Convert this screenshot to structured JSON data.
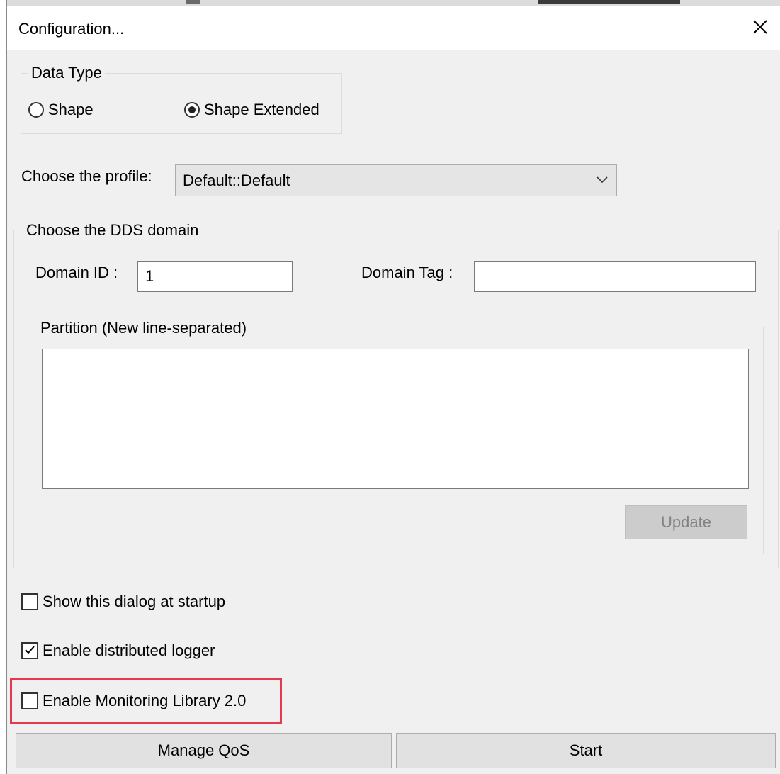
{
  "window": {
    "title": "Configuration..."
  },
  "data_type": {
    "legend": "Data Type",
    "options": [
      {
        "label": "Shape",
        "selected": false
      },
      {
        "label": "Shape Extended",
        "selected": true
      }
    ]
  },
  "profile": {
    "label": "Choose the profile:",
    "value": "Default::Default"
  },
  "dds_domain": {
    "legend": "Choose the DDS domain",
    "domain_id_label": "Domain ID :",
    "domain_id_value": "1",
    "domain_tag_label": "Domain Tag :",
    "domain_tag_value": "",
    "partition": {
      "legend": "Partition (New line-separated)",
      "value": ""
    },
    "update_label": "Update"
  },
  "checkboxes": [
    {
      "label": "Show this dialog at startup",
      "checked": false
    },
    {
      "label": "Enable distributed logger",
      "checked": true
    },
    {
      "label": "Enable Monitoring Library 2.0",
      "checked": false,
      "highlighted": true
    }
  ],
  "buttons": {
    "manage_qos": "Manage QoS",
    "start": "Start"
  },
  "colors": {
    "highlight": "#e53a4d",
    "background": "#f0f0f0"
  }
}
